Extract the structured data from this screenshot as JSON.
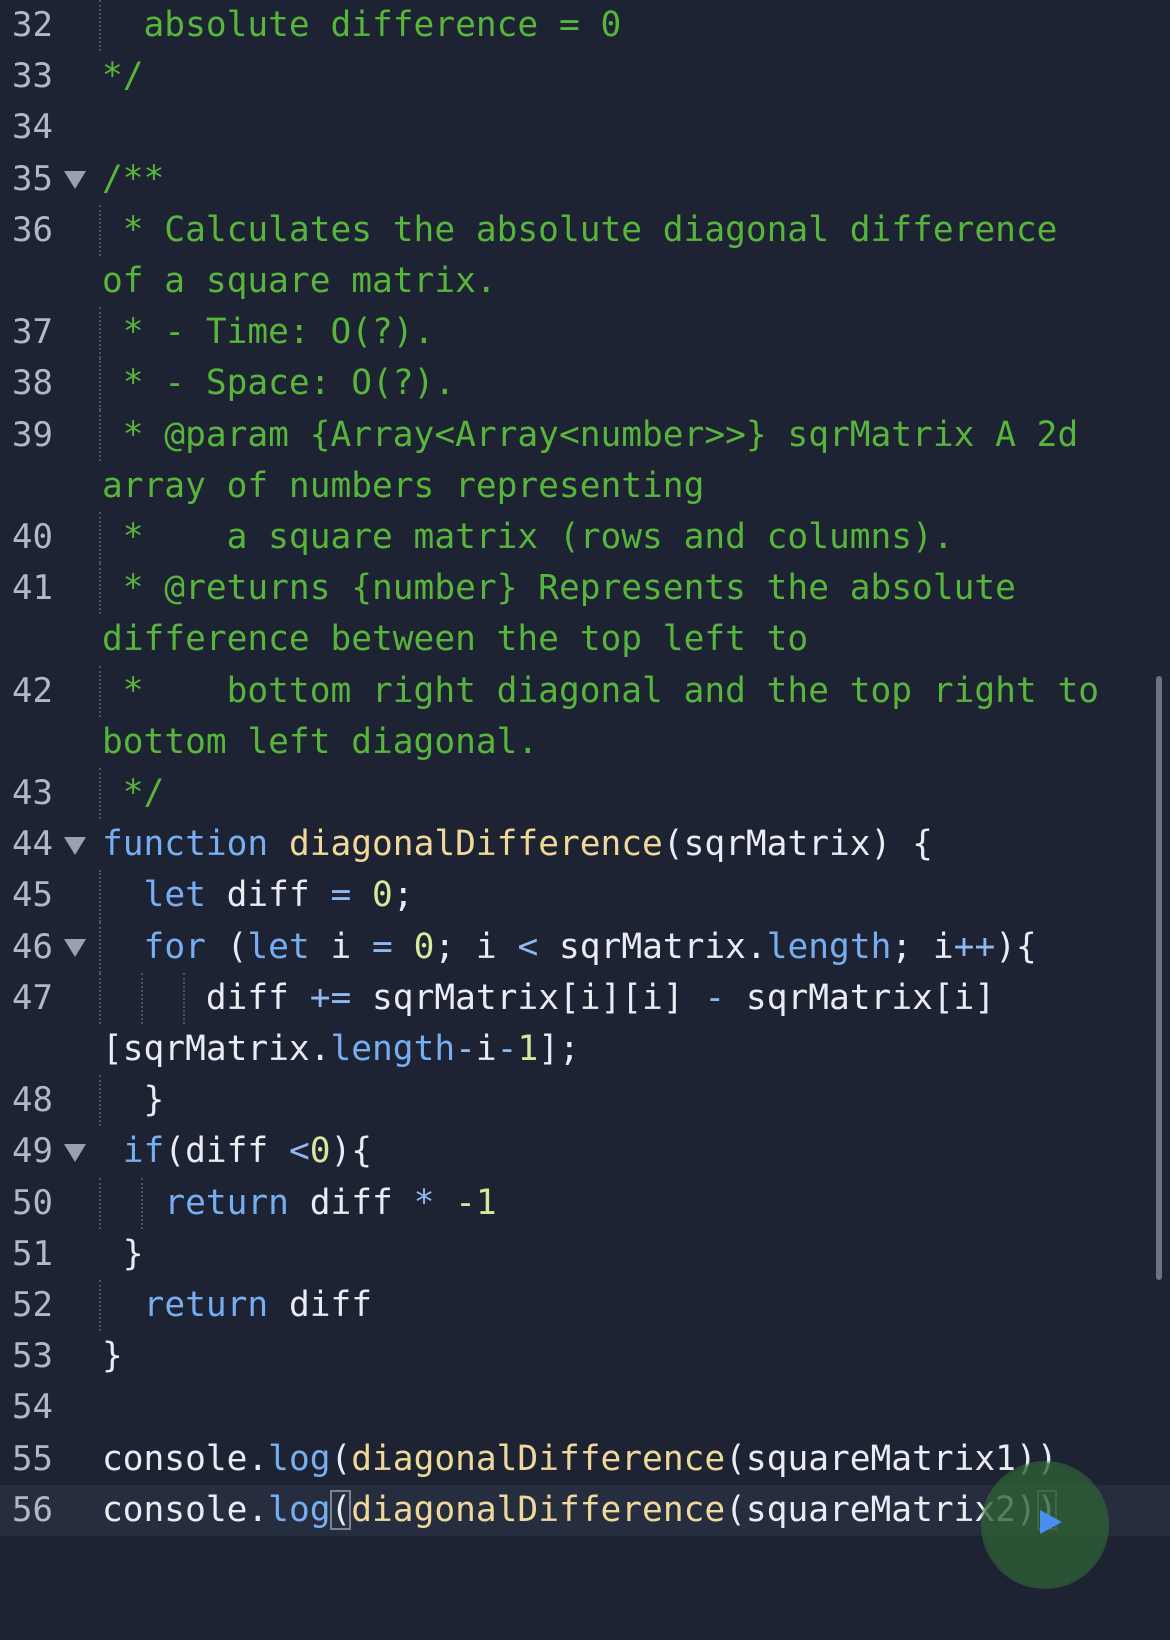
{
  "editor": {
    "lines": [
      {
        "no": "32",
        "fold": false,
        "active": false,
        "segs": [
          [
            "c-com",
            "  absolute difference = 0"
          ]
        ],
        "cont": []
      },
      {
        "no": "33",
        "fold": false,
        "active": false,
        "segs": [
          [
            "c-com",
            "*/"
          ]
        ],
        "cont": []
      },
      {
        "no": "34",
        "fold": false,
        "active": false,
        "segs": [],
        "cont": []
      },
      {
        "no": "35",
        "fold": true,
        "active": false,
        "segs": [
          [
            "c-com",
            "/**"
          ]
        ],
        "cont": []
      },
      {
        "no": "36",
        "fold": false,
        "active": false,
        "segs": [
          [
            "c-com",
            " * Calculates the absolute diagonal difference"
          ]
        ],
        "cont": [
          [
            "c-com",
            "of a square matrix."
          ]
        ]
      },
      {
        "no": "37",
        "fold": false,
        "active": false,
        "segs": [
          [
            "c-com",
            " * - Time: O(?)."
          ]
        ],
        "cont": []
      },
      {
        "no": "38",
        "fold": false,
        "active": false,
        "segs": [
          [
            "c-com",
            " * - Space: O(?)."
          ]
        ],
        "cont": []
      },
      {
        "no": "39",
        "fold": false,
        "active": false,
        "segs": [
          [
            "c-com",
            " * @param {Array<Array<number>>} sqrMatrix A 2d"
          ]
        ],
        "cont": [
          [
            "c-com",
            "array of numbers representing"
          ]
        ]
      },
      {
        "no": "40",
        "fold": false,
        "active": false,
        "segs": [
          [
            "c-com",
            " *    a square matrix (rows and columns)."
          ]
        ],
        "cont": []
      },
      {
        "no": "41",
        "fold": false,
        "active": false,
        "segs": [
          [
            "c-com",
            " * @returns {number} Represents the absolute"
          ]
        ],
        "cont": [
          [
            "c-com",
            "difference between the top left to"
          ]
        ]
      },
      {
        "no": "42",
        "fold": false,
        "active": false,
        "segs": [
          [
            "c-com",
            " *    bottom right diagonal and the top right to"
          ]
        ],
        "cont": [
          [
            "c-com",
            "bottom left diagonal."
          ]
        ]
      },
      {
        "no": "43",
        "fold": false,
        "active": false,
        "segs": [
          [
            "c-com",
            " */"
          ]
        ],
        "cont": []
      },
      {
        "no": "44",
        "fold": true,
        "active": false,
        "segs": [
          [
            "c-kw",
            "function"
          ],
          [
            "c-pl",
            " "
          ],
          [
            "c-fn",
            "diagonalDifference"
          ],
          [
            "c-pl",
            "(sqrMatrix) {"
          ]
        ],
        "cont": []
      },
      {
        "no": "45",
        "fold": false,
        "active": false,
        "segs": [
          [
            "c-pl",
            "  "
          ],
          [
            "c-kw",
            "let"
          ],
          [
            "c-pl",
            " diff "
          ],
          [
            "c-op",
            "="
          ],
          [
            "c-pl",
            " "
          ],
          [
            "c-num",
            "0"
          ],
          [
            "c-pl",
            ";"
          ]
        ],
        "cont": []
      },
      {
        "no": "46",
        "fold": true,
        "active": false,
        "segs": [
          [
            "c-pl",
            "  "
          ],
          [
            "c-kw",
            "for"
          ],
          [
            "c-pl",
            " ("
          ],
          [
            "c-kw",
            "let"
          ],
          [
            "c-pl",
            " i "
          ],
          [
            "c-op",
            "="
          ],
          [
            "c-pl",
            " "
          ],
          [
            "c-num",
            "0"
          ],
          [
            "c-pl",
            "; i "
          ],
          [
            "c-op",
            "<"
          ],
          [
            "c-pl",
            " sqrMatrix."
          ],
          [
            "c-kw",
            "length"
          ],
          [
            "c-pl",
            "; i"
          ],
          [
            "c-op",
            "++"
          ],
          [
            "c-pl",
            "){"
          ]
        ],
        "cont": []
      },
      {
        "no": "47",
        "fold": false,
        "active": false,
        "segs": [
          [
            "c-pl",
            "     diff "
          ],
          [
            "c-op",
            "+="
          ],
          [
            "c-pl",
            " sqrMatrix[i][i] "
          ],
          [
            "c-op",
            "-"
          ],
          [
            "c-pl",
            " sqrMatrix[i]"
          ]
        ],
        "cont": [
          [
            "c-pl",
            "[sqrMatrix."
          ],
          [
            "c-kw",
            "length"
          ],
          [
            "c-op",
            "-"
          ],
          [
            "c-pl",
            "i"
          ],
          [
            "c-op",
            "-"
          ],
          [
            "c-num",
            "1"
          ],
          [
            "c-pl",
            "];"
          ]
        ]
      },
      {
        "no": "48",
        "fold": false,
        "active": false,
        "segs": [
          [
            "c-pl",
            "  }"
          ]
        ],
        "cont": []
      },
      {
        "no": "49",
        "fold": true,
        "active": false,
        "segs": [
          [
            "c-pl",
            " "
          ],
          [
            "c-kw",
            "if"
          ],
          [
            "c-pl",
            "(diff "
          ],
          [
            "c-op",
            "<"
          ],
          [
            "c-num",
            "0"
          ],
          [
            "c-pl",
            "){"
          ]
        ],
        "cont": []
      },
      {
        "no": "50",
        "fold": false,
        "active": false,
        "segs": [
          [
            "c-pl",
            "   "
          ],
          [
            "c-kw",
            "return"
          ],
          [
            "c-pl",
            " diff "
          ],
          [
            "c-op",
            "*"
          ],
          [
            "c-pl",
            " "
          ],
          [
            "c-num",
            "-1"
          ]
        ],
        "cont": []
      },
      {
        "no": "51",
        "fold": false,
        "active": false,
        "segs": [
          [
            "c-pl",
            " }"
          ]
        ],
        "cont": []
      },
      {
        "no": "52",
        "fold": false,
        "active": false,
        "segs": [
          [
            "c-pl",
            "  "
          ],
          [
            "c-kw",
            "return"
          ],
          [
            "c-pl",
            " diff"
          ]
        ],
        "cont": []
      },
      {
        "no": "53",
        "fold": false,
        "active": false,
        "segs": [
          [
            "c-pl",
            "}"
          ]
        ],
        "cont": []
      },
      {
        "no": "54",
        "fold": false,
        "active": false,
        "segs": [],
        "cont": []
      },
      {
        "no": "55",
        "fold": false,
        "active": false,
        "segs": [
          [
            "c-pl",
            "console."
          ],
          [
            "c-kw",
            "log"
          ],
          [
            "c-pl",
            "("
          ],
          [
            "c-fn",
            "diagonalDifference"
          ],
          [
            "c-pl",
            "(squareMatrix1))"
          ]
        ],
        "cont": []
      },
      {
        "no": "56",
        "fold": false,
        "active": true,
        "segs": [
          [
            "c-pl",
            "console."
          ],
          [
            "c-kw",
            "log"
          ],
          [
            "c-pl bracket",
            "("
          ],
          [
            "c-fn",
            "diagonalDifference"
          ],
          [
            "c-pl",
            "(squareMatrix2)"
          ],
          [
            "c-pl bracket",
            ")"
          ]
        ],
        "cont": []
      }
    ]
  },
  "run_button": {
    "icon": "play-icon",
    "accent": "#4a8ff0"
  },
  "colors": {
    "background": "#1d2333",
    "comment": "#58b53b",
    "keyword": "#77aef2",
    "function": "#efd89a",
    "number": "#d6e89a"
  }
}
